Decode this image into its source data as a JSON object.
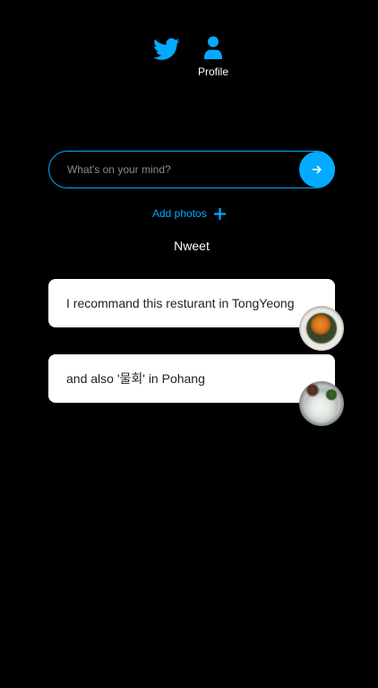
{
  "nav": {
    "home_icon": "twitter-bird-icon",
    "profile_icon": "user-icon",
    "profile_label": "Profile"
  },
  "composer": {
    "placeholder": "What's on your mind?",
    "value": "",
    "submit_icon": "arrow-right-icon"
  },
  "add_photos": {
    "label": "Add photos",
    "icon": "plus-icon"
  },
  "feed": {
    "title": "Nweet",
    "items": [
      {
        "text": "I recommand this resturant in TongYeong",
        "photo": "food-photo-thumbnail"
      },
      {
        "text": "and also '물회' in Pohang",
        "photo": "food-photo-thumbnail"
      }
    ]
  },
  "colors": {
    "accent": "#04aaff",
    "background": "#000000",
    "card": "#ffffff",
    "text_on_dark": "#ffffff",
    "text_on_card": "#222222"
  }
}
